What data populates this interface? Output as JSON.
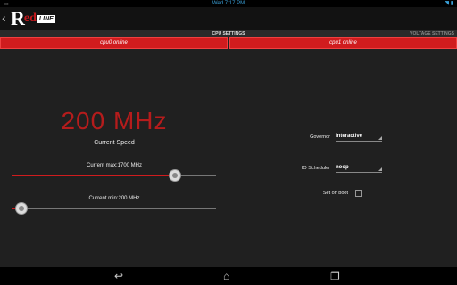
{
  "status": {
    "clock": "Wed 7:17 PM"
  },
  "header": {
    "logo_r": "R",
    "logo_ed": "ed",
    "logo_line": "LINE"
  },
  "tabs": {
    "cpu": "CPU SETTINGS",
    "voltage": "VOLTAGE SETTINGS"
  },
  "cpus": [
    {
      "label": "cpu0 online"
    },
    {
      "label": "cpu1 online"
    }
  ],
  "speed": {
    "value": "200 MHz",
    "label": "Current Speed"
  },
  "sliders": {
    "max": {
      "label": "Current max:1700 MHz",
      "fraction": 0.8
    },
    "min": {
      "label": "Current min:200 MHz",
      "fraction": 0.05
    }
  },
  "options": {
    "governor": {
      "label": "Governor",
      "value": "interactive"
    },
    "io_scheduler": {
      "label": "IO Scheduler",
      "value": "noop"
    },
    "set_on_boot": {
      "label": "Set on boot",
      "checked": false
    }
  },
  "colors": {
    "accent": "#d01c1e",
    "speed_text": "#b51c1c",
    "clock": "#3aa0d8"
  },
  "icons": [
    "back-chevron-icon",
    "nav-back-icon",
    "nav-home-icon",
    "nav-recents-icon",
    "wifi-icon",
    "battery-icon"
  ]
}
